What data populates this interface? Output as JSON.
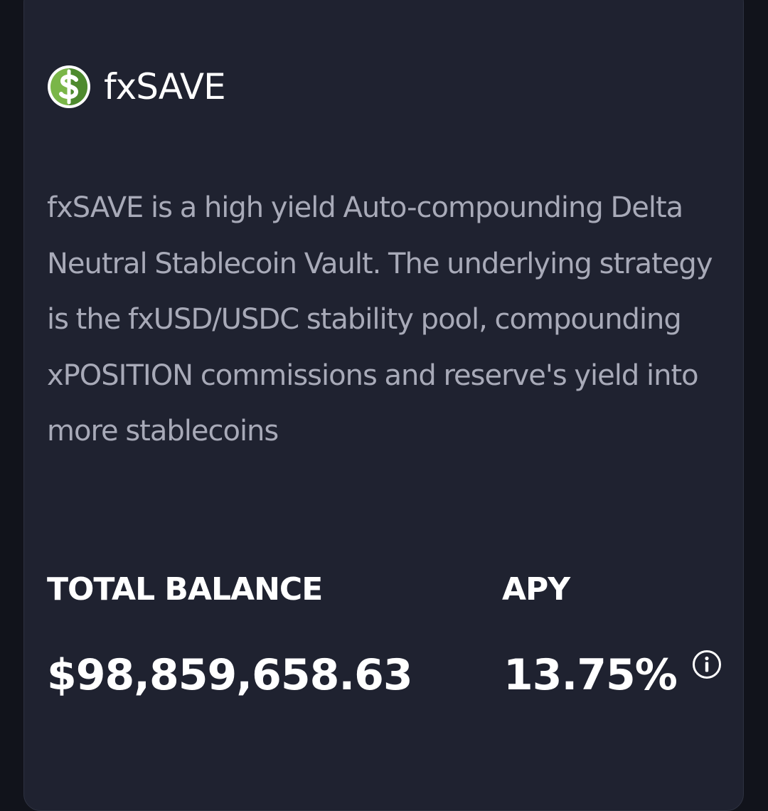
{
  "vault": {
    "name": "fxSAVE",
    "logo_icon": "dollar-coin-icon",
    "description": "fxSAVE is a high yield Auto-compounding Delta Neutral Stablecoin Vault. The underlying strategy is the fxUSD/USDC stability pool, compounding xPOSITION commissions and reserve's yield into more stablecoins"
  },
  "stats": {
    "total_balance_label": "TOTAL BALANCE",
    "total_balance_value": "$98,859,658.63",
    "apy_label": "APY",
    "apy_value": "13.75%",
    "apy_info_icon": "info-icon"
  },
  "colors": {
    "page_background": "#11131b",
    "card_background": "#1f2230",
    "text_primary": "#ffffff",
    "text_secondary": "#a8aab8",
    "logo_green": "#7ab648"
  }
}
